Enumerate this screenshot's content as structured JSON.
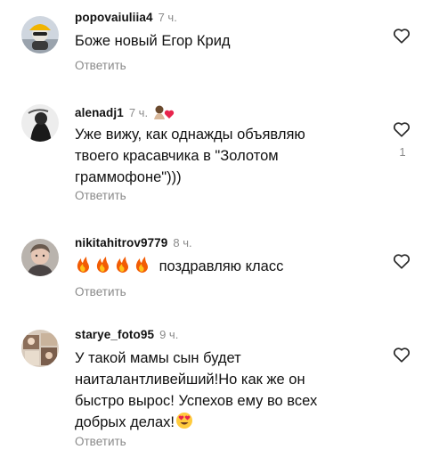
{
  "comments": [
    {
      "username": "popovaiuliia4",
      "time": "7 ч.",
      "text": "Боже новый Егор Крид",
      "reply_label": "Ответить"
    },
    {
      "username": "alenadj1",
      "time": "7 ч.",
      "text_line1": "Уже вижу, как однажды объявляю",
      "text_line2": "твоего красавчика в \"Золотом",
      "text_line3": "граммофоне\")))",
      "reply_label": "Ответить",
      "like_count": "1"
    },
    {
      "username": "nikitahitrov9779",
      "time": "8 ч.",
      "emoji_prefix": "🔥🔥🔥🔥",
      "text": "поздравляю класс",
      "reply_label": "Ответить"
    },
    {
      "username": "starye_foto95",
      "time": "9 ч.",
      "text_line1": "У такой мамы сын будет",
      "text_line2": "наиталантливейший!Но как же он",
      "text_line3": "быстро вырос! Успехов ему во всех",
      "text_line4": "добрых делах!",
      "reply_label": "Ответить"
    }
  ],
  "icons": {
    "like": "heart-outline-icon",
    "creator": "creator-badge-icon",
    "fire": "fire-emoji",
    "heart_eyes": "heart-eyes-emoji"
  },
  "colors": {
    "secondary_text": "#8a8a8a",
    "primary_text": "#111111",
    "badge_heart": "#e8244c"
  }
}
